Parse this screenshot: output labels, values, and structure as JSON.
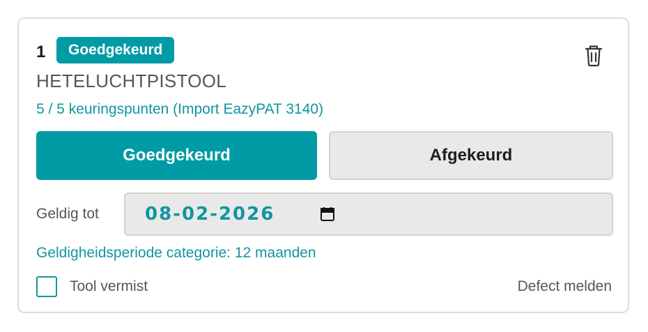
{
  "item": {
    "number": "1",
    "status_badge": "Goedgekeurd",
    "tool_name": "HETELUCHTPISTOOL",
    "inspection_points": "5 / 5 keuringspunten (Import EazyPAT 3140)",
    "delete_icon": "trash-icon"
  },
  "actions": {
    "approve_label": "Goedgekeurd",
    "reject_label": "Afgekeurd"
  },
  "validity": {
    "label": "Geldig tot",
    "date_value": "08-02-2026",
    "calendar_icon": "calendar-icon",
    "period_text": "Geldigheidsperiode categorie: 12 maanden"
  },
  "footer": {
    "missing_label": "Tool vermist",
    "missing_checked": false,
    "defect_label": "Defect melden"
  },
  "colors": {
    "accent": "#009ba5",
    "link_text": "#10969f",
    "muted_text": "#555555",
    "field_bg": "#e9e9e9"
  }
}
